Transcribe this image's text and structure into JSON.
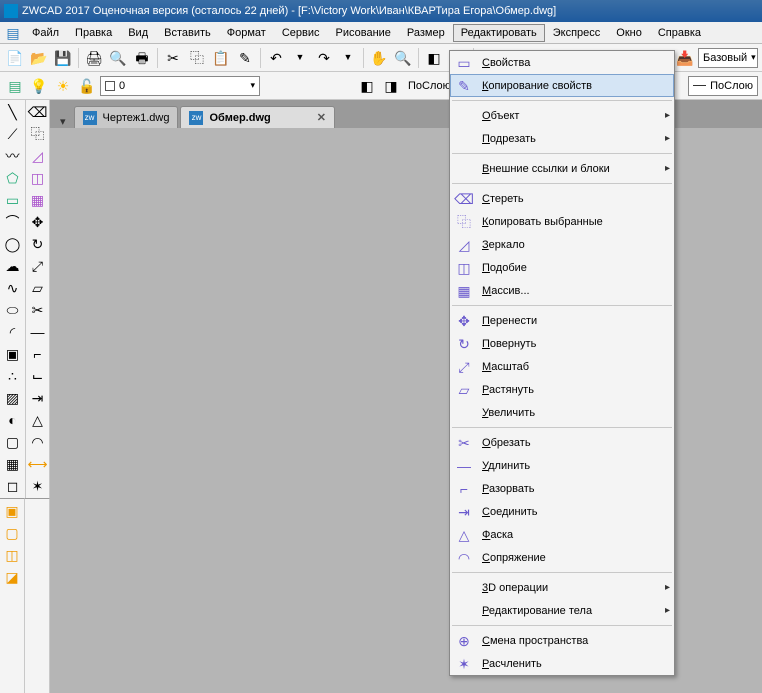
{
  "title": "ZWCAD 2017 Оценочная версия (осталось 22 дней) - [F:\\Victory Work\\Иван\\КВАРТира Егора\\Обмер.dwg]",
  "menubar": [
    "Файл",
    "Правка",
    "Вид",
    "Вставить",
    "Формат",
    "Сервис",
    "Рисование",
    "Размер",
    "Редактировать",
    "Экспресс",
    "Окно",
    "Справка"
  ],
  "toolbar2": {
    "layer": "0",
    "bylayer_label": "ПоСлою",
    "base_label": "Базовый",
    "bylayer2": "ПоСлою"
  },
  "tabs": [
    {
      "label": "Чертеж1.dwg",
      "active": false
    },
    {
      "label": "Обмер.dwg",
      "active": true
    }
  ],
  "dropdown": {
    "items": [
      {
        "label": "Свойства",
        "icon": "▭"
      },
      {
        "label": "Копирование свойств",
        "icon": "✎",
        "hover": true
      },
      {
        "sep": true
      },
      {
        "label": "Объект",
        "submenu": true
      },
      {
        "label": "Подрезать",
        "submenu": true
      },
      {
        "sep": true
      },
      {
        "label": "Внешние ссылки и блоки",
        "submenu": true
      },
      {
        "sep": true
      },
      {
        "label": "Стереть",
        "icon": "⌫"
      },
      {
        "label": "Копировать выбранные",
        "icon": "⿻"
      },
      {
        "label": "Зеркало",
        "icon": "◿"
      },
      {
        "label": "Подобие",
        "icon": "◫"
      },
      {
        "label": "Массив...",
        "icon": "▦"
      },
      {
        "sep": true
      },
      {
        "label": "Перенести",
        "icon": "✥"
      },
      {
        "label": "Повернуть",
        "icon": "↻"
      },
      {
        "label": "Масштаб",
        "icon": "⤢"
      },
      {
        "label": "Растянуть",
        "icon": "▱"
      },
      {
        "label": "Увеличить"
      },
      {
        "sep": true
      },
      {
        "label": "Обрезать",
        "icon": "✂"
      },
      {
        "label": "Удлинить",
        "icon": "—"
      },
      {
        "label": "Разорвать",
        "icon": "⌐"
      },
      {
        "label": "Соединить",
        "icon": "⇥"
      },
      {
        "label": "Фаска",
        "icon": "△"
      },
      {
        "label": "Сопряжение",
        "icon": "◠"
      },
      {
        "sep": true
      },
      {
        "label": "3D операции",
        "submenu": true,
        "ul": "3"
      },
      {
        "label": "Редактирование тела",
        "submenu": true
      },
      {
        "sep": true
      },
      {
        "label": "Смена пространства",
        "icon": "⊕"
      },
      {
        "label": "Расчленить",
        "icon": "✶"
      }
    ]
  }
}
